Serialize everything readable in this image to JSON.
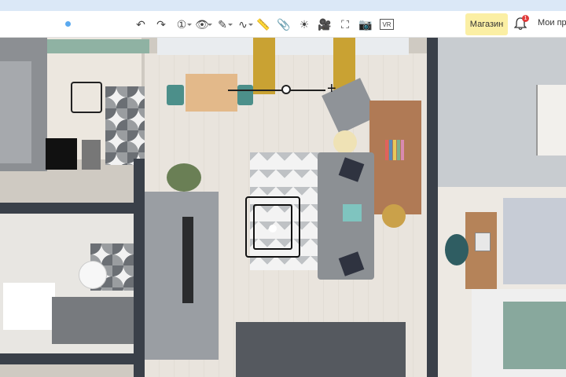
{
  "toolbar": {
    "shop_label": "Магазин",
    "notifications_count": "1",
    "my_projects_label": "Мои пр",
    "tools": [
      {
        "name": "undo-icon",
        "glyph": "↶"
      },
      {
        "name": "redo-icon",
        "glyph": "↷"
      },
      {
        "name": "floor-level-icon",
        "glyph": "①"
      },
      {
        "name": "eye-icon",
        "glyph": "👁"
      },
      {
        "name": "measure-pen-icon",
        "glyph": "✎"
      },
      {
        "name": "curve-icon",
        "glyph": "∿"
      },
      {
        "name": "ruler-icon",
        "glyph": "📏"
      },
      {
        "name": "paperclip-icon",
        "glyph": "📎"
      },
      {
        "name": "light-icon",
        "glyph": "☀"
      },
      {
        "name": "video-camera-icon",
        "glyph": "🎥"
      },
      {
        "name": "fit-view-icon",
        "glyph": "⛶"
      },
      {
        "name": "photo-camera-icon",
        "glyph": "📷"
      },
      {
        "name": "vr-icon",
        "glyph": "VR"
      }
    ]
  },
  "zoom": {
    "plus_glyph": "+",
    "level": 0.6
  },
  "colors": {
    "accent_blue": "#5aa9ef",
    "shop_bg": "#fbefa4",
    "badge_red": "#e23b3b",
    "curtain": "#c9a233",
    "wall": "#3a4049"
  }
}
